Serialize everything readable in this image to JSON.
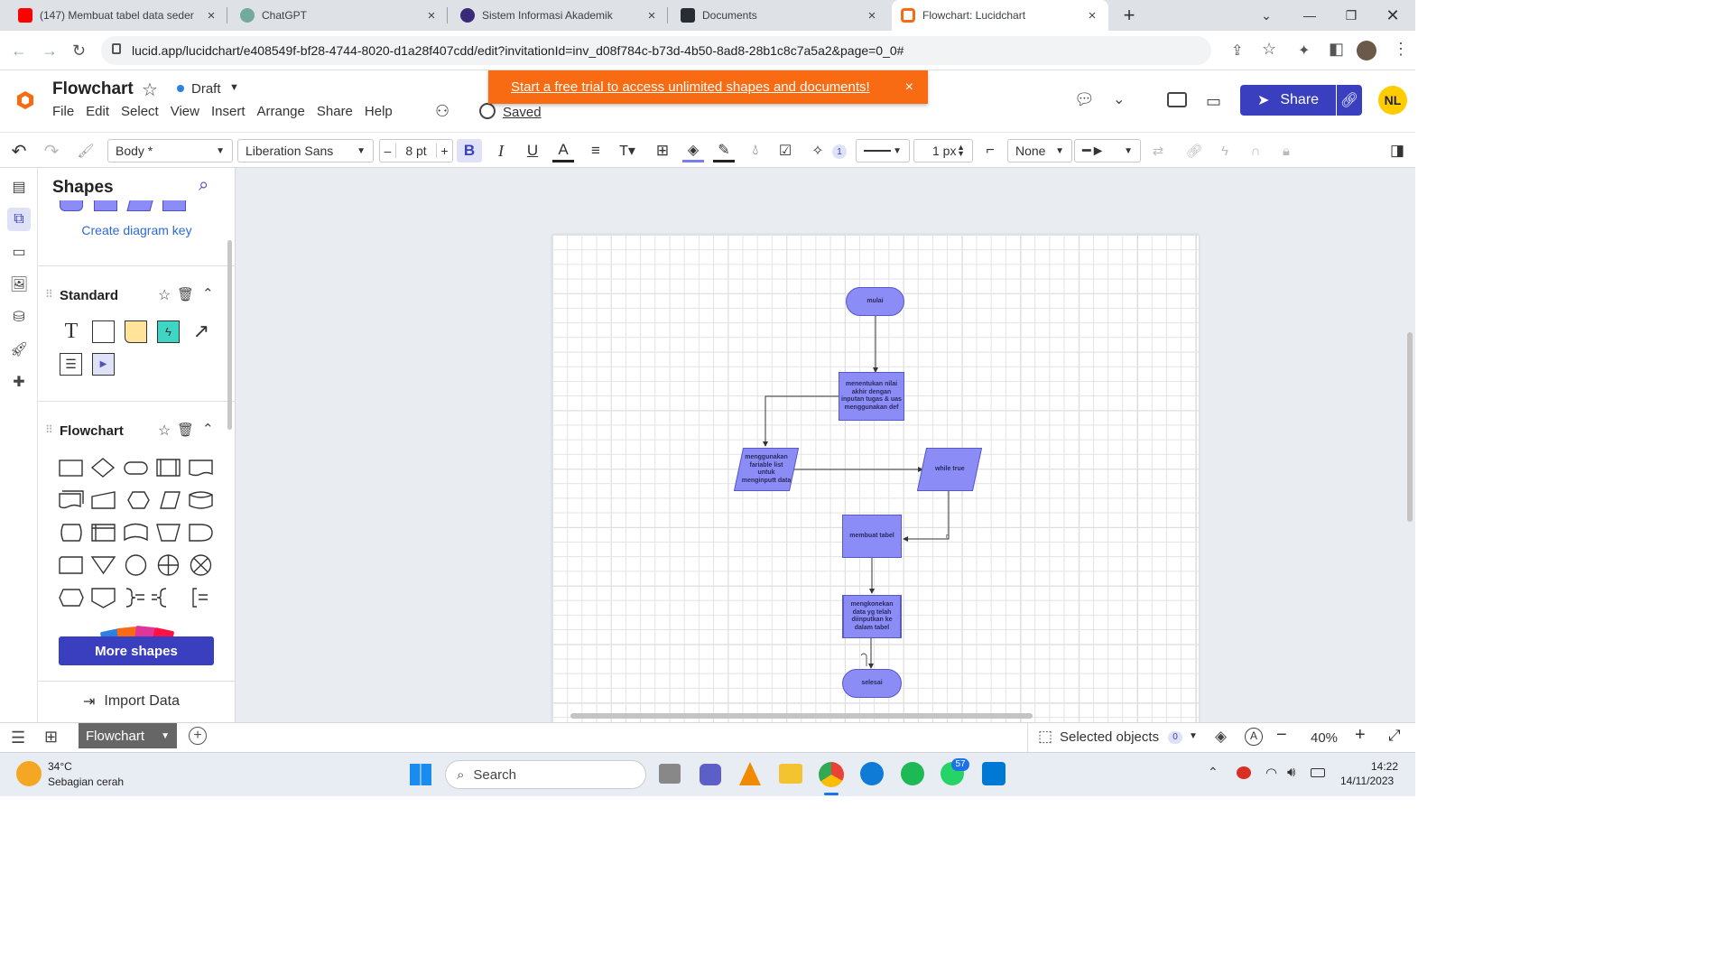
{
  "browser": {
    "tabs": [
      {
        "title": "(147) Membuat tabel data seder",
        "icon": "youtube-icon",
        "color": "#ff0000"
      },
      {
        "title": "ChatGPT",
        "icon": "chatgpt-icon",
        "color": "#74aa9c"
      },
      {
        "title": "Sistem Informasi Akademik",
        "icon": "university-icon",
        "color": "#3b2a7a"
      },
      {
        "title": "Documents",
        "icon": "lucid-icon",
        "color": "#282c33"
      },
      {
        "title": "Flowchart: Lucidchart",
        "icon": "lucidchart-icon",
        "color": "#f96b13"
      }
    ],
    "new_tab": "+",
    "url": "lucid.app/lucidchart/e408549f-bf28-4744-8020-d1a28f407cdd/edit?invitationId=inv_d08f784c-b73d-4b50-8ad8-28b1c8c7a5a2&page=0_0#"
  },
  "app": {
    "doc_title": "Flowchart",
    "status": "Draft",
    "menu": [
      "File",
      "Edit",
      "Select",
      "View",
      "Insert",
      "Arrange",
      "Share",
      "Help"
    ],
    "saved": "Saved",
    "banner": "Start a free trial to access unlimited shapes and documents!",
    "banner_color": "#f96b13",
    "share_label": "Share",
    "avatar": "NL",
    "accent": "#3a3fc0"
  },
  "toolbar": {
    "text_style": "Body *",
    "font": "Liberation Sans",
    "font_size": "8 pt",
    "minus": "–",
    "plus": "+",
    "bold": "B",
    "italic": "I",
    "underline": "U",
    "badge": "1",
    "line_width": "1 px",
    "line_start": "None"
  },
  "panel": {
    "title": "Shapes",
    "diagram_key": "Create diagram key",
    "standard_title": "Standard",
    "flowchart_title": "Flowchart",
    "more_shapes": "More shapes",
    "import_data": "Import Data"
  },
  "diagram": {
    "nodes": [
      {
        "id": "mulai",
        "text": "mulai",
        "shape": "terminator"
      },
      {
        "id": "proc1",
        "text": "menentukan nilai akhir dengan inputan tugas & uas menggunakan def",
        "shape": "process"
      },
      {
        "id": "io1",
        "text": "menggunakan fariable list untuk menginputt data",
        "shape": "data"
      },
      {
        "id": "io2",
        "text": "while true",
        "shape": "data"
      },
      {
        "id": "proc2",
        "text": "membuat tabel",
        "shape": "process"
      },
      {
        "id": "proc3",
        "text": "mengkonekan data yg telah diinputkan ke dalam tabel",
        "shape": "predefined-process"
      },
      {
        "id": "selesai",
        "text": "selesai",
        "shape": "terminator"
      }
    ],
    "edge_label": "n",
    "shape_fill": "#8b8cf5"
  },
  "bottom": {
    "page_tab": "Flowchart",
    "selected_objects": "Selected objects",
    "selected_count": "0",
    "zoom": "40%"
  },
  "taskbar": {
    "temp": "34°C",
    "weather": "Sebagian cerah",
    "search": "Search",
    "badge": "57",
    "time": "14:22",
    "date": "14/11/2023"
  }
}
